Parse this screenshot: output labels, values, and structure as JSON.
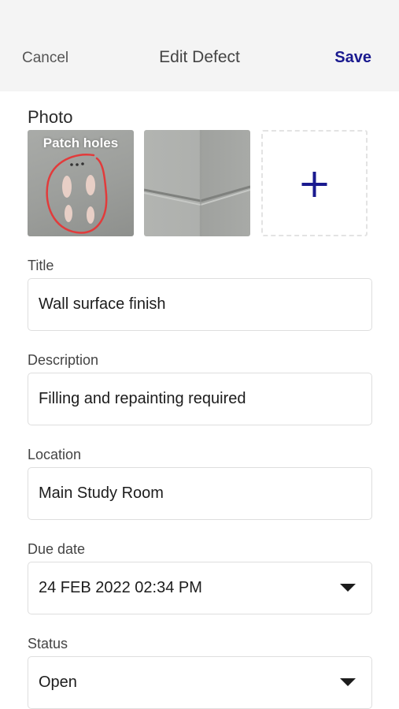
{
  "header": {
    "cancel_label": "Cancel",
    "title": "Edit Defect",
    "save_label": "Save"
  },
  "photo": {
    "label": "Photo",
    "items": [
      {
        "caption": "Patch holes"
      },
      {
        "caption": ""
      }
    ]
  },
  "form": {
    "title": {
      "label": "Title",
      "value": "Wall surface finish"
    },
    "description": {
      "label": "Description",
      "value": "Filling and repainting required"
    },
    "location": {
      "label": "Location",
      "value": "Main Study Room"
    },
    "due_date": {
      "label": "Due date",
      "value": "24 FEB 2022 02:34 PM"
    },
    "status": {
      "label": "Status",
      "value": "Open"
    }
  },
  "colors": {
    "header_bg": "#f4f4f4",
    "accent": "#1a1a8f",
    "border": "#dedede"
  }
}
